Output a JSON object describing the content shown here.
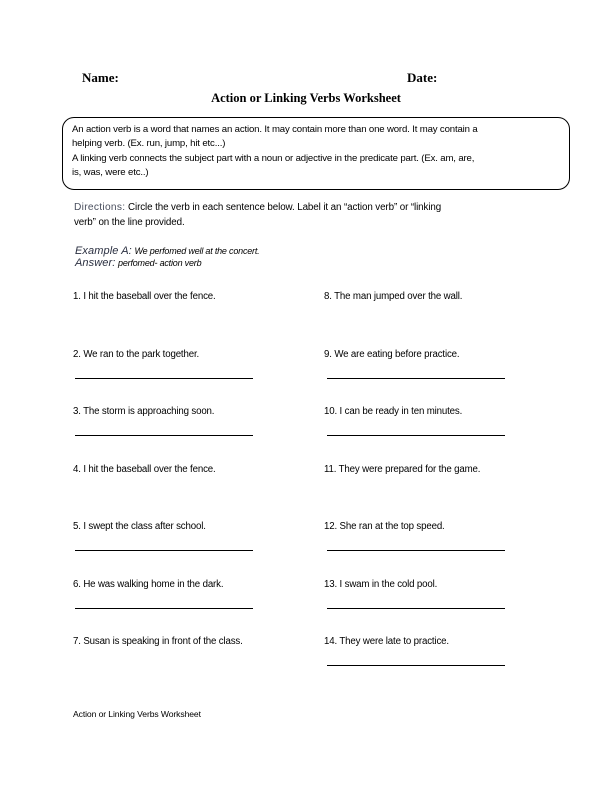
{
  "header": {
    "name_label": "Name:",
    "date_label": "Date:",
    "title": "Action or Linking Verbs Worksheet"
  },
  "definitions": {
    "action_line1": "An action verb is a word that names an action. It may contain more than one word. It may contain a",
    "action_line2": "helping verb. (Ex. run, jump, hit etc...)",
    "linking_line1": "A linking verb connects the subject part with a noun or adjective in the predicate part. (Ex. am, are,",
    "linking_line2": "is, was, were etc..)"
  },
  "directions": {
    "label": "Directions:",
    "text_line1": "Circle the verb in each sentence below. Label it an “action verb” or “linking",
    "text_line2": "verb” on the line provided."
  },
  "example": {
    "label": "Example A:",
    "sentence": "We perfomed well at the concert.",
    "answer_label": "Answer:",
    "answer": "perfomed- action verb"
  },
  "questions_left": [
    {
      "text": "1. I hit the baseball over the fence.",
      "has_line": false
    },
    {
      "text": "2. We ran to the park together.",
      "has_line": true
    },
    {
      "text": "3. The storm is approaching soon.",
      "has_line": true
    },
    {
      "text": "4. I hit the baseball over the fence.",
      "has_line": false
    },
    {
      "text": "5. I swept the class after school.",
      "has_line": true
    },
    {
      "text": "6. He was walking home in the dark.",
      "has_line": true
    },
    {
      "text": "7. Susan is speaking in front of the class.",
      "has_line": false
    }
  ],
  "questions_right": [
    {
      "text": "8. The man jumped over the wall.",
      "has_line": false
    },
    {
      "text": "9. We are eating before practice.",
      "has_line": true
    },
    {
      "text": "10. I can be ready in ten minutes.",
      "has_line": true
    },
    {
      "text": "11. They were prepared for the game.",
      "has_line": false
    },
    {
      "text": "12. She ran at the top speed.",
      "has_line": true
    },
    {
      "text": "13. I swam in the cold pool.",
      "has_line": true
    },
    {
      "text": "14. They were late to practice.",
      "has_line": true
    }
  ],
  "footer": {
    "text": "Action or Linking Verbs Worksheet"
  }
}
